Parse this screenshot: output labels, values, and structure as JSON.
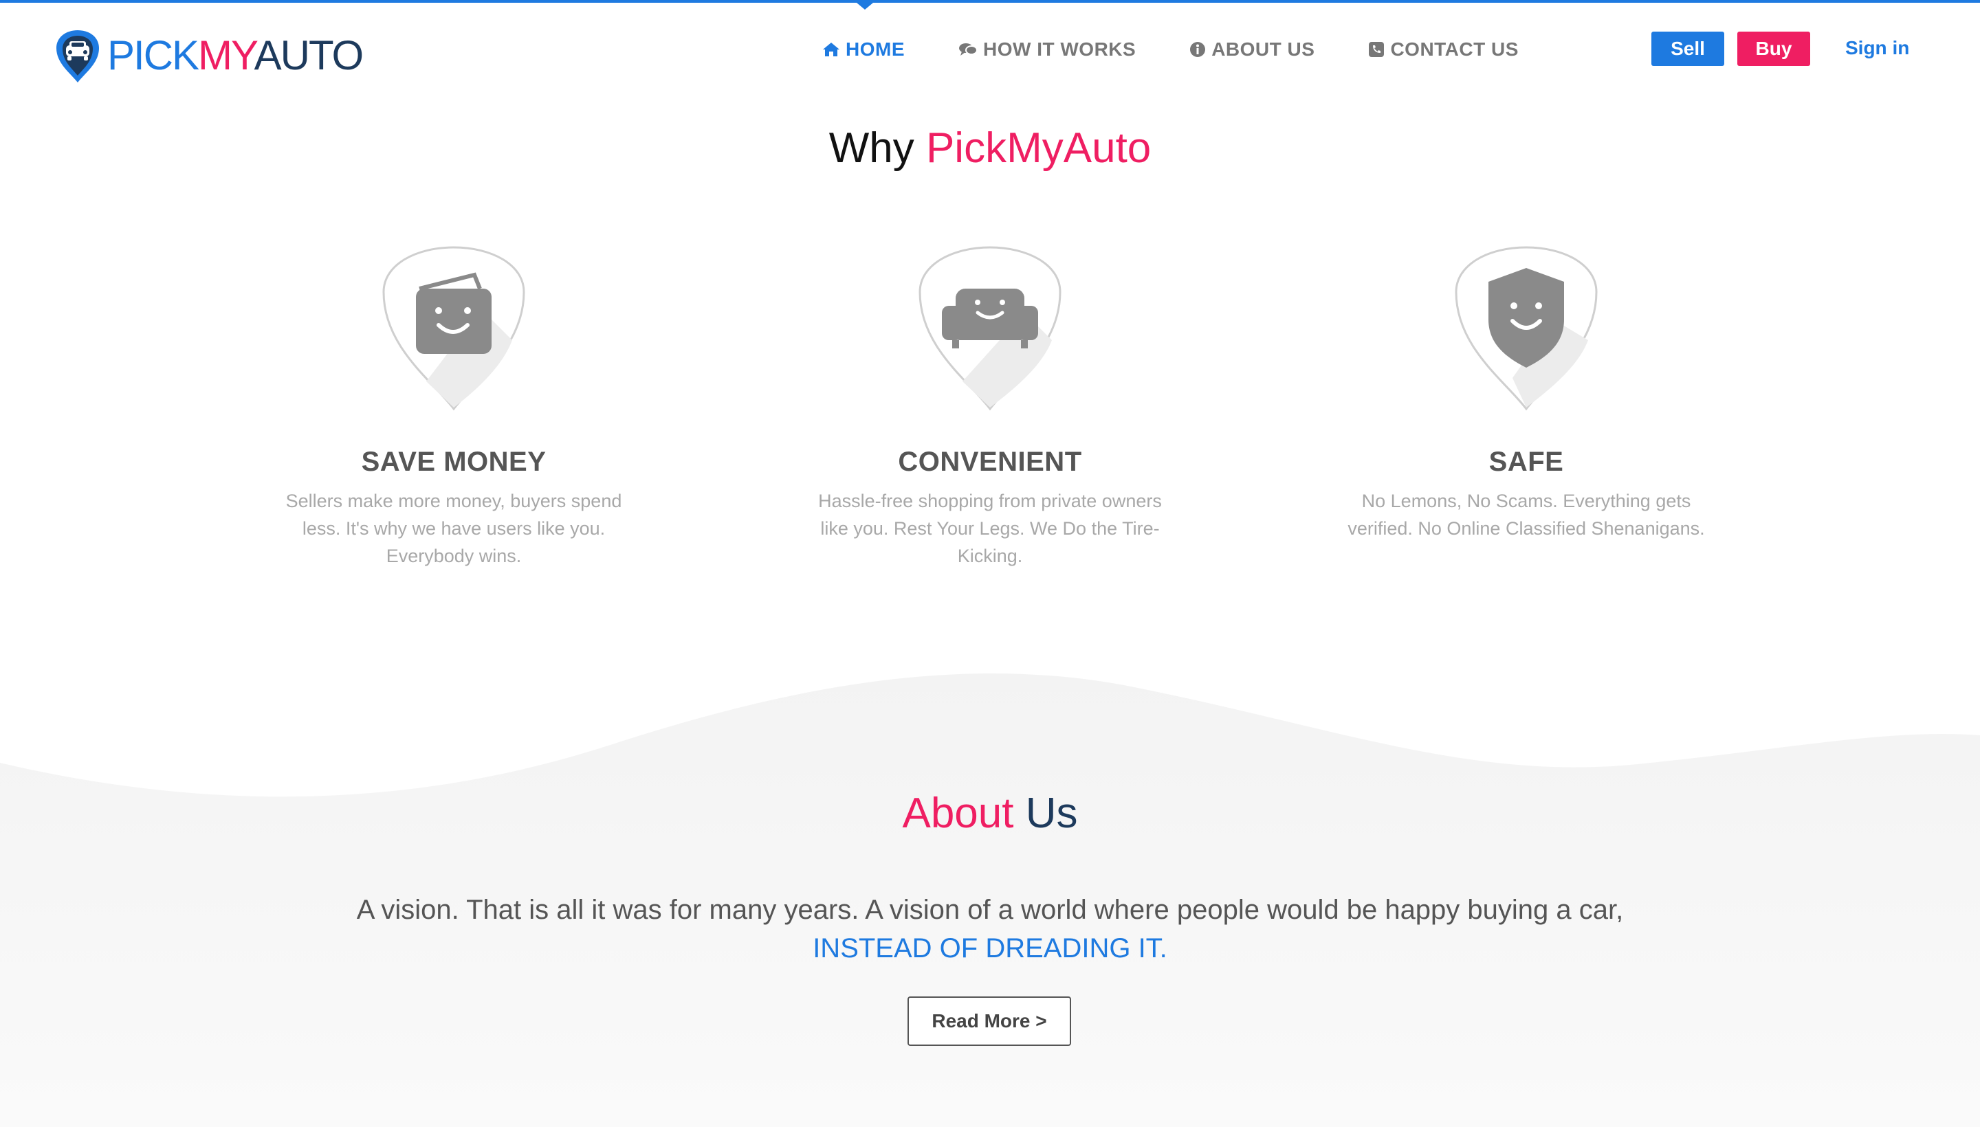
{
  "brand": {
    "logo_parts": [
      "PICK",
      "MY",
      "AUTO"
    ],
    "colors": {
      "blue": "#1e7ae0",
      "pink": "#ef1e62",
      "navy": "#1d3a5c"
    }
  },
  "nav": {
    "items": [
      {
        "label": "HOME",
        "icon": "home-icon",
        "active": true
      },
      {
        "label": "HOW IT WORKS",
        "icon": "comments-icon",
        "active": false
      },
      {
        "label": "ABOUT US",
        "icon": "info-circle-icon",
        "active": false
      },
      {
        "label": "CONTACT US",
        "icon": "phone-square-icon",
        "active": false
      }
    ]
  },
  "header_actions": {
    "sell": "Sell",
    "buy": "Buy",
    "signin": "Sign in"
  },
  "why": {
    "title_plain": "Why",
    "title_accent": "PickMyAuto",
    "features": [
      {
        "icon": "wallet-smile-icon",
        "title": "SAVE MONEY",
        "desc": "Sellers make more money, buyers spend less. It's why we have users like you. Everybody wins."
      },
      {
        "icon": "couch-smile-icon",
        "title": "CONVENIENT",
        "desc": "Hassle-free shopping from private owners like you. Rest Your Legs. We Do the Tire-Kicking."
      },
      {
        "icon": "shield-smile-icon",
        "title": "SAFE",
        "desc": "No Lemons, No Scams. Everything gets verified. No Online Classified Shenanigans."
      }
    ]
  },
  "about": {
    "title_accent": "About",
    "title_plain": "Us",
    "text": "A vision. That is all it was for many years. A vision of a world where people would be happy buying a car,",
    "highlight": "INSTEAD OF DREADING IT.",
    "button": "Read More >"
  }
}
